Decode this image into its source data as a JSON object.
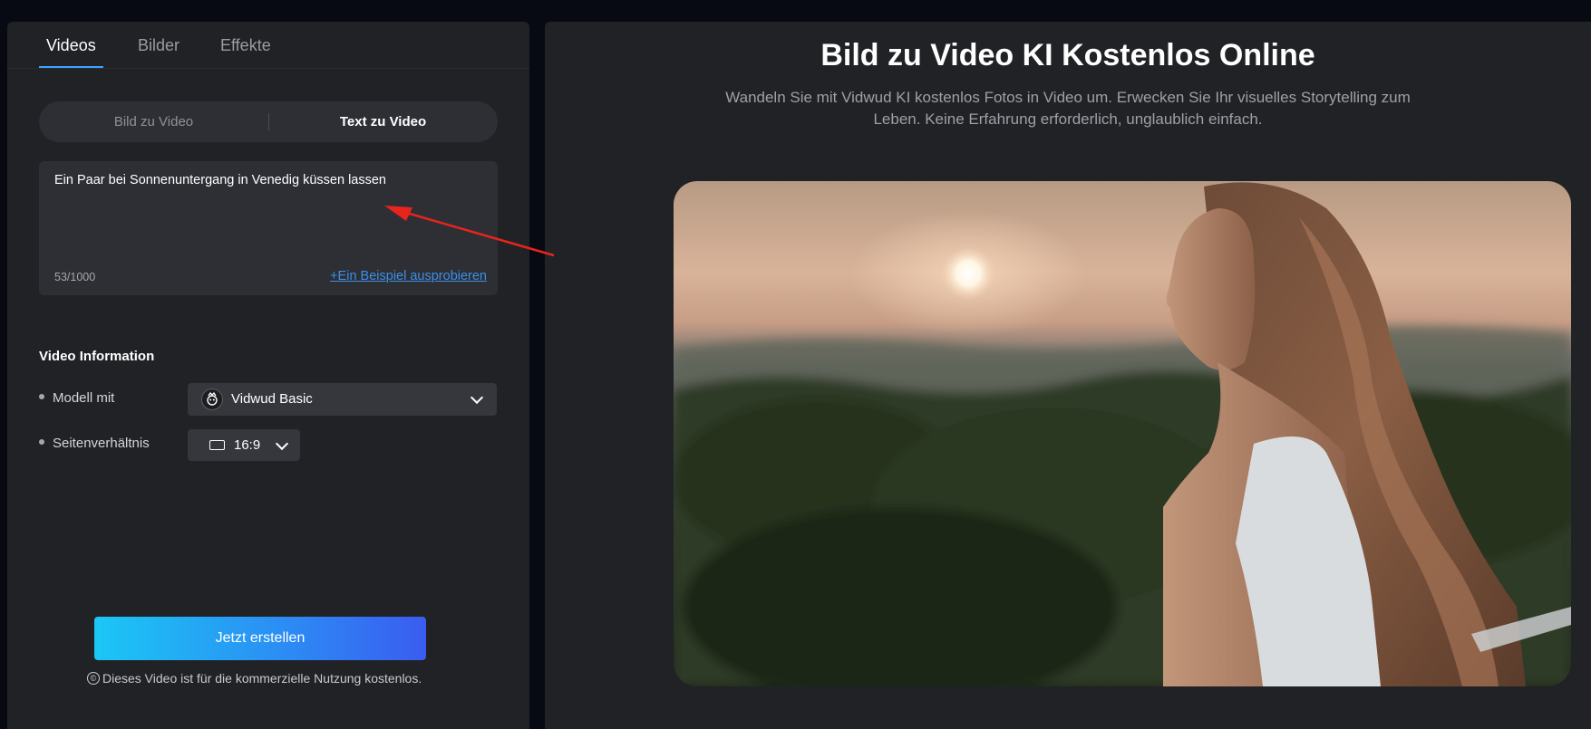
{
  "tabs": [
    "Videos",
    "Bilder",
    "Effekte"
  ],
  "mode": {
    "inactive": "Bild zu Video",
    "active": "Text zu Video"
  },
  "prompt": {
    "text": "Ein Paar bei Sonnenuntergang in Venedig küssen lassen",
    "count": "53/1000",
    "example_link": "+Ein Beispiel ausprobieren"
  },
  "video_info": {
    "title": "Video Information",
    "model_label": "Modell mit",
    "model_value": "Vidwud Basic",
    "ratio_label": "Seitenverhältnis",
    "ratio_value": "16:9"
  },
  "create_button": "Jetzt erstellen",
  "notice": "Dieses Video ist für die kommerzielle Nutzung kostenlos.",
  "notice_icon": "©",
  "hero": {
    "title": "Bild zu Video KI Kostenlos Online",
    "subtitle": "Wandeln Sie mit Vidwud KI kostenlos Fotos in Video um. Erwecken Sie Ihr visuelles Storytelling zum Leben. Keine Erfahrung erforderlich, unglaublich einfach."
  },
  "colors": {
    "accent": "#3ea0ff",
    "link": "#3d8fe6",
    "arrow": "#e8241c",
    "panel": "#212226"
  },
  "icons": [
    "vidwud-logo-icon",
    "chevron-down-icon",
    "aspect-ratio-icon",
    "copyright-icon",
    "annotation-arrow"
  ]
}
